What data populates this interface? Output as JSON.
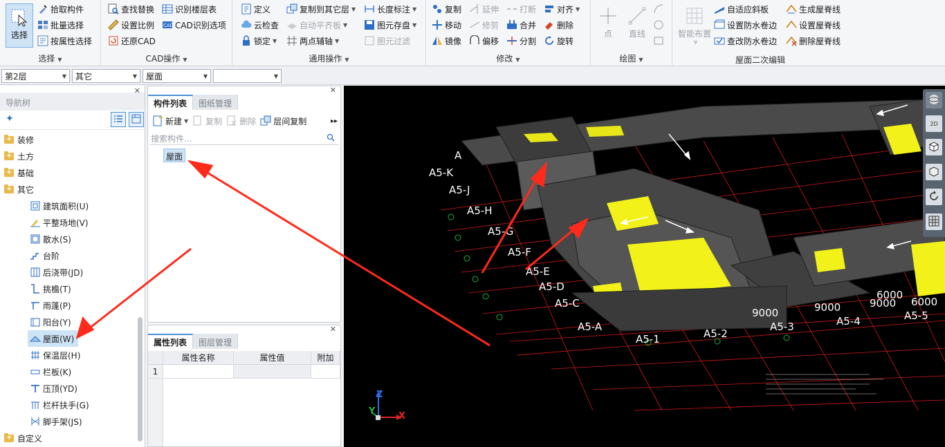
{
  "ribbon": {
    "select": {
      "big_label": "选择",
      "pick": "拾取构件",
      "batch": "批量选择",
      "by_attr": "按属性选择",
      "group": "选择"
    },
    "cad": {
      "find_replace": "查找替换",
      "set_ratio": "设置比例",
      "restore": "还原CAD",
      "identify_floor": "识别楼层表",
      "cad_options": "CAD识别选项",
      "group": "CAD操作"
    },
    "common": {
      "define": "定义",
      "cloud_check": "云检查",
      "lock": "锁定",
      "copy_other": "复制到其它层",
      "auto_slab": "自动平齐板",
      "two_points": "两点辅轴",
      "length_mark": "长度标注",
      "elem_save": "图元存盘",
      "elem_filter": "图元过滤",
      "group": "通用操作"
    },
    "modify": {
      "copy": "复制",
      "move": "移动",
      "mirror": "镜像",
      "extend": "延伸",
      "trim": "修剪",
      "offset": "偏移",
      "break": "打断",
      "merge": "合并",
      "split": "分割",
      "align": "对齐",
      "delete": "删除",
      "rotate": "旋转",
      "group": "修改"
    },
    "draw": {
      "point": "点",
      "line": "直线",
      "group": "绘图"
    },
    "roof": {
      "smart": "智能布置",
      "fit_slope": "自适应斜板",
      "set_wp_roll": "设置防水卷边",
      "check_wp_roll": "查改防水卷边",
      "gen_ridge": "生成屋脊线",
      "set_ridge": "设置屋脊线",
      "del_ridge": "删除屋脊线",
      "group": "屋面二次编辑"
    }
  },
  "filters": {
    "floor": "第2层",
    "category": "其它",
    "type": "屋面",
    "extra": ""
  },
  "nav": {
    "title": "导航树",
    "folders": [
      {
        "label": "装修",
        "y": 0
      },
      {
        "label": "土方",
        "y": 24
      },
      {
        "label": "基础",
        "y": 48
      },
      {
        "label": "其它",
        "y": 72
      }
    ],
    "children": [
      {
        "label": "建筑面积(U)",
        "icon": "building-area-icon"
      },
      {
        "label": "平整场地(V)",
        "icon": "site-leveling-icon"
      },
      {
        "label": "散水(S)",
        "icon": "apron-icon"
      },
      {
        "label": "台阶",
        "icon": "steps-icon"
      },
      {
        "label": "后浇带(JD)",
        "icon": "post-cast-strip-icon"
      },
      {
        "label": "挑檐(T)",
        "icon": "cornice-icon"
      },
      {
        "label": "雨蓬(P)",
        "icon": "canopy-icon"
      },
      {
        "label": "阳台(Y)",
        "icon": "balcony-icon"
      },
      {
        "label": "屋面(W)",
        "icon": "roof-icon",
        "selected": true
      },
      {
        "label": "保温层(H)",
        "icon": "insulation-icon"
      },
      {
        "label": "栏板(K)",
        "icon": "parapet-icon"
      },
      {
        "label": "压顶(YD)",
        "icon": "coping-icon"
      },
      {
        "label": "栏杆扶手(G)",
        "icon": "railing-icon"
      },
      {
        "label": "脚手架(JS)",
        "icon": "scaffold-icon"
      }
    ],
    "last_folder": "自定义"
  },
  "components": {
    "tab_list": "构件列表",
    "tab_drawings": "图纸管理",
    "new": "新建",
    "copy": "复制",
    "delete": "删除",
    "floor_copy": "层间复制",
    "search_placeholder": "搜索构件...",
    "items": [
      "屋面"
    ]
  },
  "properties": {
    "tab_props": "属性列表",
    "tab_layers": "图层管理",
    "columns": [
      "属性名称",
      "属性值",
      "附加"
    ],
    "row_index": "1"
  },
  "viewport": {
    "axis_labels_left": [
      "A",
      "A5-K",
      "A5-J",
      "A5-H",
      "A5-G",
      "A5-F",
      "A5-E",
      "A5-D",
      "A5-C",
      "A5-A"
    ],
    "axis_labels_bottom": [
      "A5-1",
      "A5-2",
      "A5-3",
      "A5-4",
      "A5-5"
    ],
    "dims": [
      "9000",
      "9000",
      "9000",
      "6000",
      "6000"
    ],
    "view_2d": "2D",
    "axis_x": "X",
    "axis_y": "Y",
    "axis_z": "Z"
  }
}
